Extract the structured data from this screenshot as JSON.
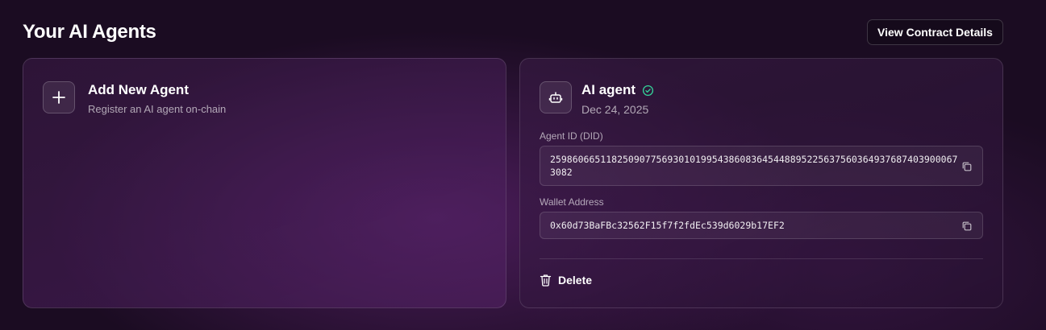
{
  "header": {
    "title": "Your AI Agents",
    "contract_button_label": "View Contract Details"
  },
  "add_card": {
    "title": "Add New Agent",
    "subtitle": "Register an AI agent on-chain",
    "icon": "plus-icon"
  },
  "agent_card": {
    "name": "AI agent",
    "verified_icon": "check-circle-icon",
    "bot_icon": "robot-icon",
    "date": "Dec 24, 2025",
    "agent_id_label": "Agent ID (DID)",
    "agent_id_value": "25986066511825090775693010199543860836454488952256375603649376874039000673082",
    "wallet_label": "Wallet Address",
    "wallet_value": "0x60d73BaFBc32562F15f7f2fdEc539d6029b17EF2",
    "copy_icon": "copy-icon",
    "delete_label": "Delete",
    "delete_icon": "trash-icon"
  },
  "colors": {
    "background": "#1b0c22",
    "verified": "#34d399"
  }
}
